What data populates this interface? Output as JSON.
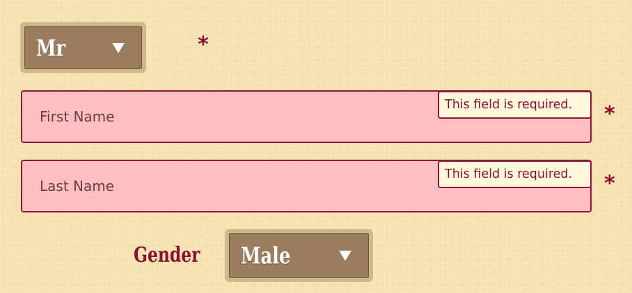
{
  "form": {
    "title_select": {
      "value": "Mr",
      "required_marker": "*"
    },
    "first_name": {
      "placeholder": "First Name",
      "value": "",
      "error": "This field is required.",
      "required_marker": "*"
    },
    "last_name": {
      "placeholder": "Last Name",
      "value": "",
      "error": "This field is required.",
      "required_marker": "*"
    },
    "gender": {
      "label": "Gender",
      "value": "Male"
    }
  },
  "icons": {
    "dropdown": "chevron-down-icon"
  },
  "colors": {
    "background": "#f7e3b3",
    "select_fill": "#9b7e5f",
    "select_frame": "#cdb98a",
    "error_field_fill": "#ffbfc2",
    "accent": "#8a1030",
    "tooltip_fill": "#fff8dc"
  }
}
